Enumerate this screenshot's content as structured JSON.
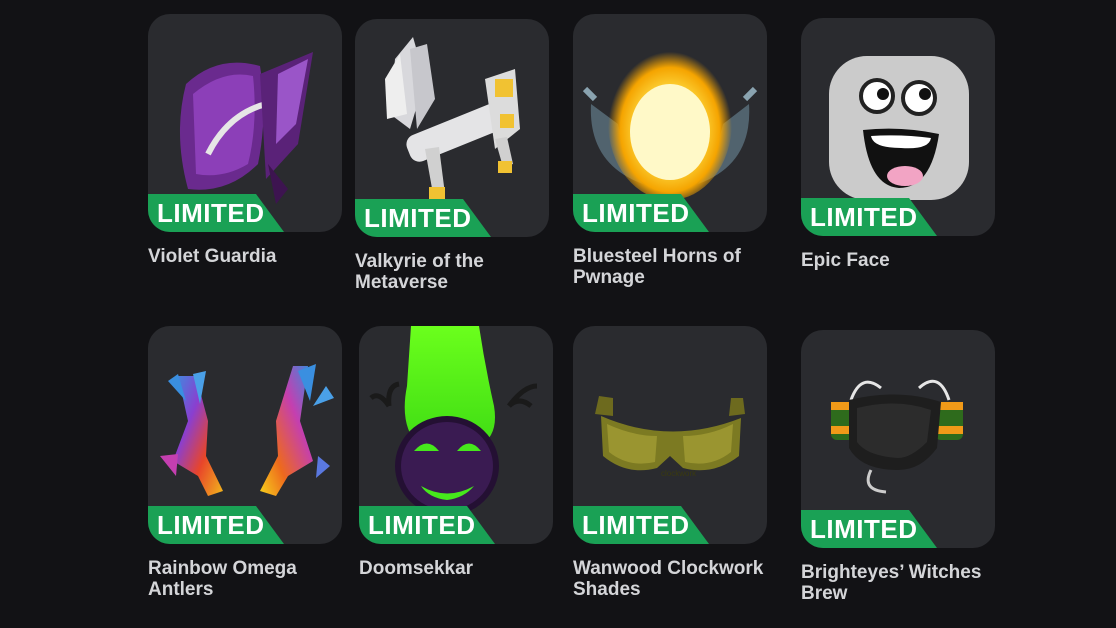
{
  "items": [
    {
      "name": "Violet Guardia",
      "badge": "LIMITED",
      "icon": "violet-guardia-icon"
    },
    {
      "name": "Valkyrie of the Metaverse",
      "badge": "LIMITED",
      "icon": "valkyrie-icon"
    },
    {
      "name": "Bluesteel Horns of Pwnage",
      "badge": "LIMITED",
      "icon": "bluesteel-horns-icon"
    },
    {
      "name": "Epic Face",
      "badge": "LIMITED",
      "icon": "epic-face-icon"
    },
    {
      "name": "Rainbow Omega Antlers",
      "badge": "LIMITED",
      "icon": "rainbow-antlers-icon"
    },
    {
      "name": "Doomsekkar",
      "badge": "LIMITED",
      "icon": "doomsekkar-icon"
    },
    {
      "name": "Wanwood Clockwork Shades",
      "badge": "LIMITED",
      "icon": "clockwork-shades-icon"
    },
    {
      "name": "Brighteyes’ Witches Brew",
      "badge": "LIMITED",
      "icon": "witches-brew-icon"
    }
  ],
  "colors": {
    "background": "#121215",
    "card": "#2a2b2f",
    "badge": "#1aa155",
    "text": "#d4d5d8"
  }
}
